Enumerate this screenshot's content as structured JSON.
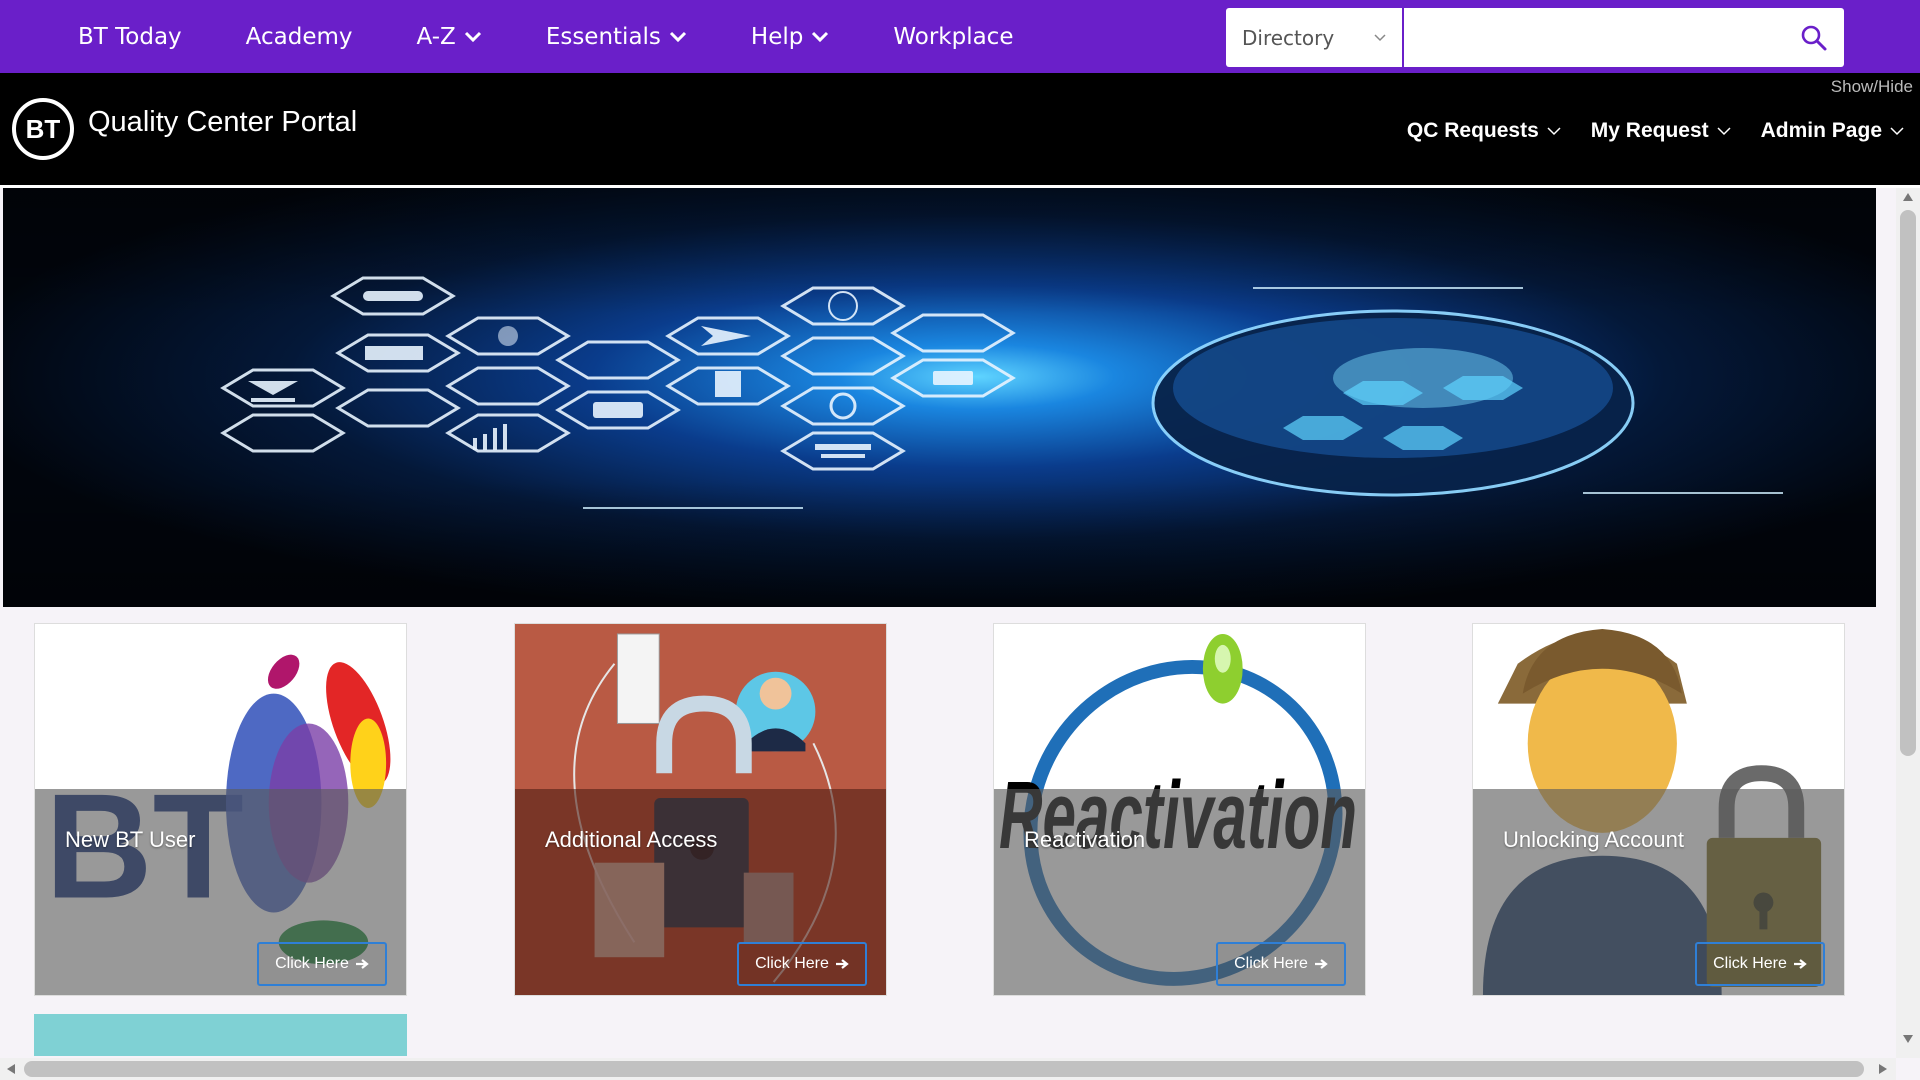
{
  "topnav": {
    "items": [
      {
        "label": "BT Today",
        "dropdown": false
      },
      {
        "label": "Academy",
        "dropdown": false
      },
      {
        "label": "A-Z",
        "dropdown": true
      },
      {
        "label": "Essentials",
        "dropdown": true
      },
      {
        "label": "Help",
        "dropdown": true
      },
      {
        "label": "Workplace",
        "dropdown": false
      }
    ],
    "search": {
      "scope": "Directory",
      "query": "",
      "placeholder": ""
    }
  },
  "header": {
    "logo_text": "BT",
    "title": "Quality Center Portal",
    "show_hide": "Show/Hide",
    "menu": [
      {
        "label": "QC Requests"
      },
      {
        "label": "My Request"
      },
      {
        "label": "Admin Page"
      }
    ]
  },
  "cards": [
    {
      "title": "New BT User",
      "button": "Click Here"
    },
    {
      "title": "Additional Access",
      "button": "Click Here"
    },
    {
      "title": "Reactivation",
      "button": "Click Here",
      "art_text": "Reactivation"
    },
    {
      "title": "Unlocking Account",
      "button": "Click Here"
    }
  ],
  "colors": {
    "topbar": "#6a1fc9",
    "header": "#000000",
    "button_border": "#2f7fd6",
    "next_card": "#7fd1d4"
  }
}
